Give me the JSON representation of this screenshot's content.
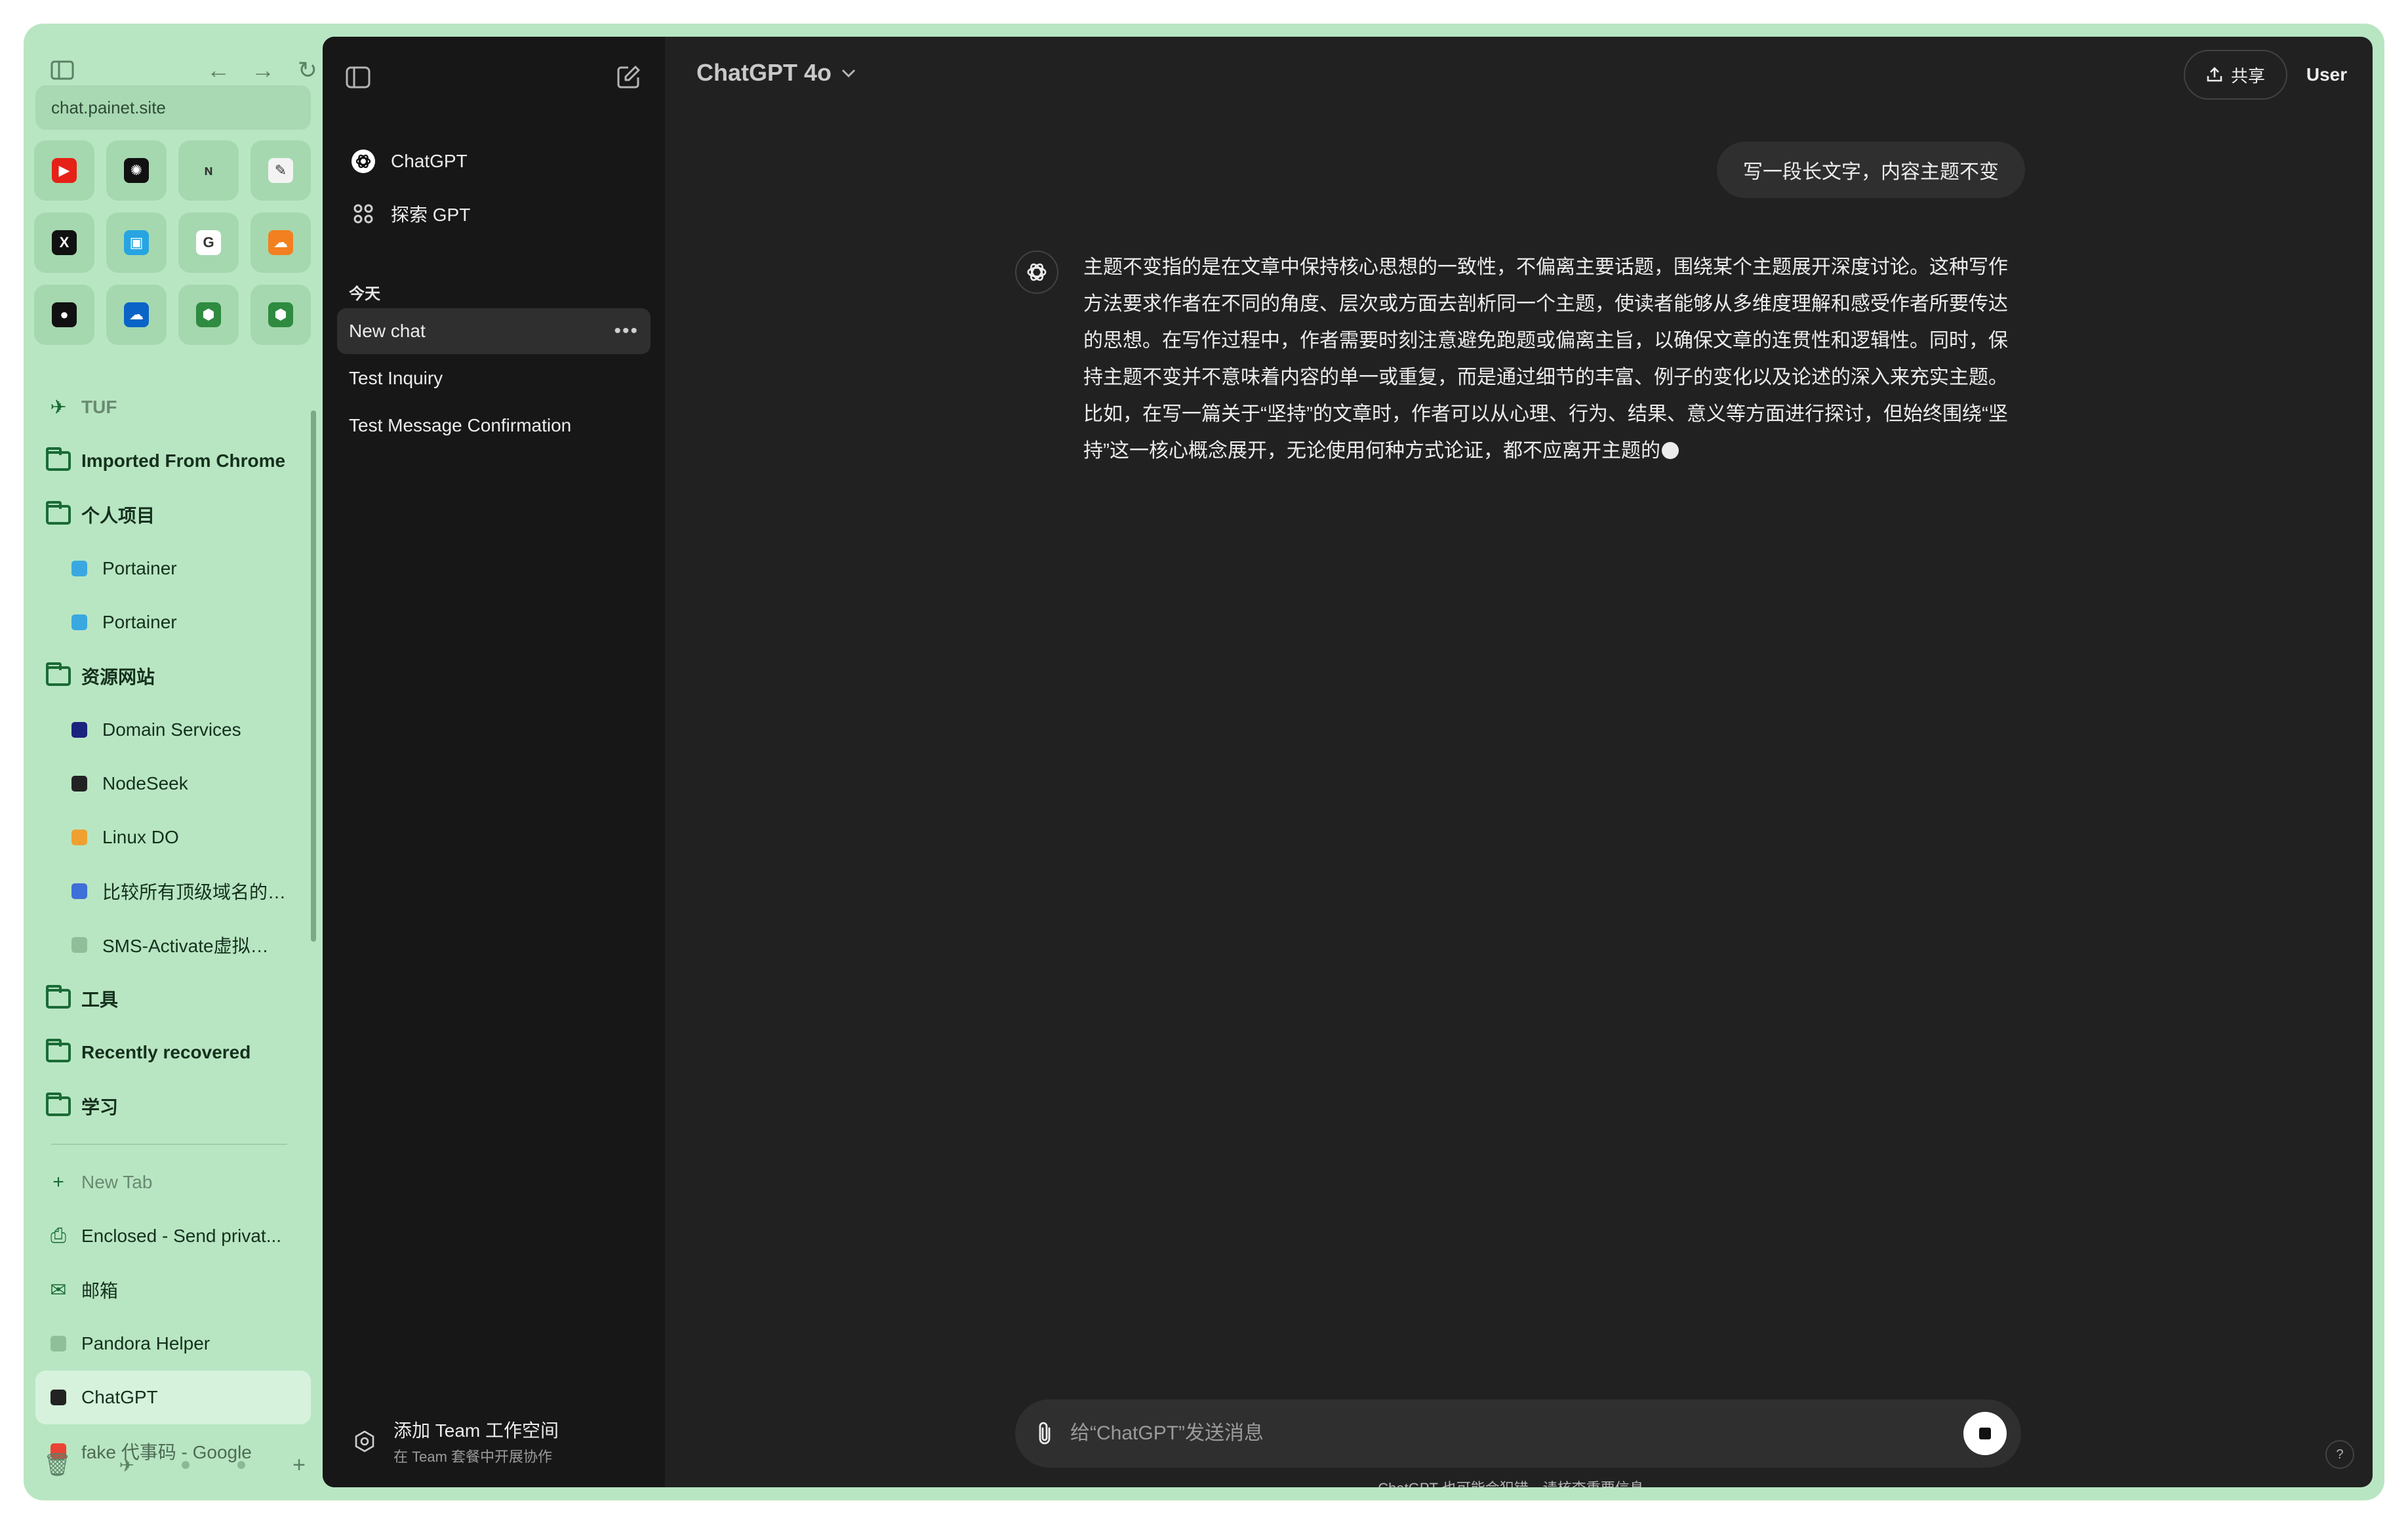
{
  "browser": {
    "url": "chat.painet.site",
    "favorites": [
      {
        "icon": "youtube-icon",
        "color": "#e62117",
        "glyph": "▶"
      },
      {
        "icon": "openai-icon",
        "color": "#111111",
        "glyph": "✺"
      },
      {
        "icon": "n-app-icon",
        "color": "#a5d8af",
        "glyph": "ɴ"
      },
      {
        "icon": "notes-app-icon",
        "color": "#f3f3f3",
        "glyph": "✎"
      },
      {
        "icon": "x-icon",
        "color": "#111111",
        "glyph": "X"
      },
      {
        "icon": "bilibili-icon",
        "color": "#27a5e1",
        "glyph": "▣"
      },
      {
        "icon": "gmail-icon",
        "color": "#ffffff",
        "glyph": "G"
      },
      {
        "icon": "cloudflare-icon",
        "color": "#f38020",
        "glyph": "☁"
      },
      {
        "icon": "github-icon",
        "color": "#111111",
        "glyph": "●"
      },
      {
        "icon": "onedrive-icon",
        "color": "#0a64c8",
        "glyph": "☁"
      },
      {
        "icon": "shield-green-icon",
        "color": "#2e8b3f",
        "glyph": "⬢"
      },
      {
        "icon": "shield-green-icon-2",
        "color": "#2e8b3f",
        "glyph": "⬢"
      }
    ],
    "tree": [
      {
        "kind": "space",
        "label": "TUF",
        "icon": "tuf-icon",
        "muted": true
      },
      {
        "kind": "folder",
        "label": "Imported From Chrome",
        "icon": "folder-icon"
      },
      {
        "kind": "folder",
        "label": "个人项目",
        "icon": "folder-dots-icon"
      },
      {
        "kind": "tab",
        "label": "Portainer",
        "icon": "portainer-icon",
        "split": true
      },
      {
        "kind": "tab",
        "label": "Portainer",
        "icon": "portainer-icon"
      },
      {
        "kind": "folder",
        "label": "资源网站",
        "icon": "folder-dots-icon"
      },
      {
        "kind": "tab",
        "label": "Domain Services",
        "icon": "domain-services-icon"
      },
      {
        "kind": "tab",
        "label": "NodeSeek",
        "icon": "nodeseek-icon"
      },
      {
        "kind": "tab",
        "label": "Linux DO",
        "icon": "linux-do-icon",
        "split": true
      },
      {
        "kind": "tab",
        "label": "比较所有顶级域名的…",
        "icon": "tld-list-icon"
      },
      {
        "kind": "tab",
        "label": "SMS-Activate虚拟…",
        "icon": "sms-activate-icon"
      },
      {
        "kind": "folder",
        "label": "工具",
        "icon": "folder-icon"
      },
      {
        "kind": "folder",
        "label": "Recently recovered",
        "icon": "folder-open-icon"
      },
      {
        "kind": "folder",
        "label": "学习",
        "icon": "folder-icon"
      }
    ],
    "tabs": [
      {
        "label": "New Tab",
        "icon": "plus-icon",
        "muted": true
      },
      {
        "label": "Enclosed - Send privat...",
        "icon": "enclosed-icon"
      },
      {
        "label": "邮箱",
        "icon": "mail-icon"
      },
      {
        "label": "Pandora Helper",
        "icon": "pandora-icon"
      },
      {
        "label": "ChatGPT",
        "icon": "chatgpt-tab-icon",
        "active": true
      },
      {
        "label": "fake 代事码 - Google",
        "icon": "google-icon",
        "faded": true
      }
    ]
  },
  "sidebar": {
    "nav": [
      {
        "label": "ChatGPT",
        "icon": "chatgpt-logo-icon"
      },
      {
        "label": "探索 GPT",
        "icon": "explore-grid-icon"
      }
    ],
    "section_title": "今天",
    "chats": [
      {
        "label": "New chat",
        "active": true
      },
      {
        "label": "Test Inquiry"
      },
      {
        "label": "Test Message Confirmation"
      }
    ],
    "team": {
      "title": "添加 Team 工作空间",
      "subtitle": "在 Team 套餐中开展协作"
    }
  },
  "header": {
    "model": "ChatGPT 4o",
    "share_label": "共享",
    "user_label": "User"
  },
  "conversation": {
    "user_message": "写一段长文字，内容主题不变",
    "assistant_message": "主题不变指的是在文章中保持核心思想的一致性，不偏离主要话题，围绕某个主题展开深度讨论。这种写作方法要求作者在不同的角度、层次或方面去剖析同一个主题，使读者能够从多维度理解和感受作者所要传达的思想。在写作过程中，作者需要时刻注意避免跑题或偏离主旨，以确保文章的连贯性和逻辑性。同时，保持主题不变并不意味着内容的单一或重复，而是通过细节的丰富、例子的变化以及论述的深入来充实主题。比如，在写一篇关于“坚持”的文章时，作者可以从心理、行为、结果、意义等方面进行探讨，但始终围绕“坚持”这一核心概念展开，无论使用何种方式论证，都不应离开主题的"
  },
  "composer": {
    "placeholder": "给“ChatGPT”发送消息",
    "disclaimer": "ChatGPT 也可能会犯错。请核查重要信息。",
    "help": "?"
  },
  "colors": {
    "arc_bg": "#b8e6c2",
    "chat_bg": "#212121",
    "sidebar_bg": "#171717"
  }
}
